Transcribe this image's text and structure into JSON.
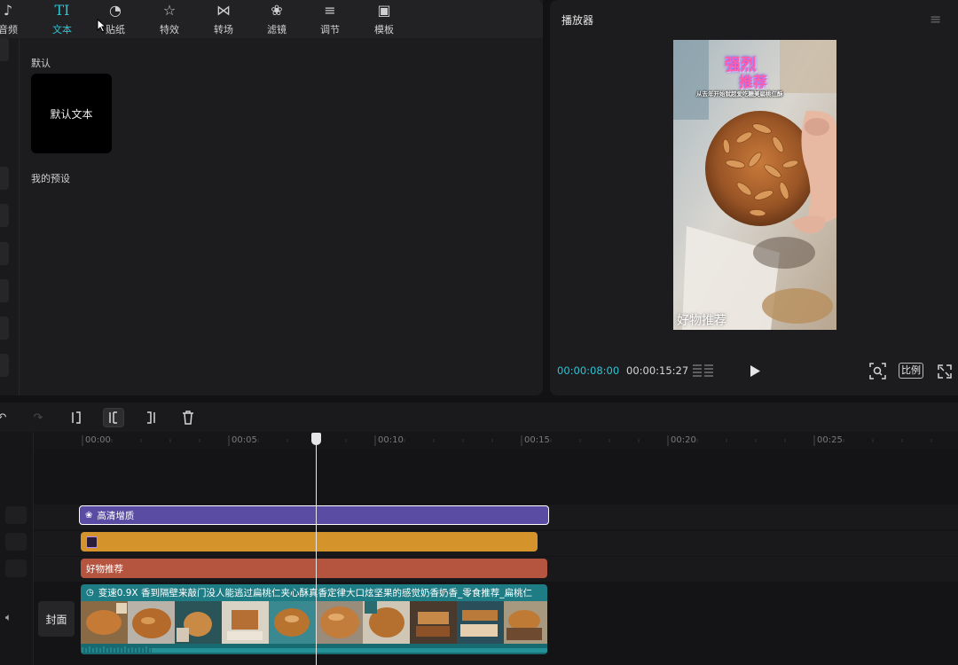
{
  "categories": [
    {
      "name": "audio",
      "label": "音频",
      "icon": "♪"
    },
    {
      "name": "text",
      "label": "文本",
      "icon": "TI"
    },
    {
      "name": "stickers",
      "label": "贴纸",
      "icon": "◔"
    },
    {
      "name": "effects",
      "label": "特效",
      "icon": "☆"
    },
    {
      "name": "transitions",
      "label": "转场",
      "icon": "⋈"
    },
    {
      "name": "filters",
      "label": "滤镜",
      "icon": "❀"
    },
    {
      "name": "adjust",
      "label": "调节",
      "icon": "≡"
    },
    {
      "name": "templates",
      "label": "模板",
      "icon": "▣"
    }
  ],
  "library": {
    "default_section": "默认",
    "default_text_card": "默认文本",
    "my_presets_section": "我的预设"
  },
  "player": {
    "title": "播放器",
    "current_time": "00:00:08:00",
    "total_time": "00:00:15:27",
    "ratio_label": "比例",
    "video_overlay_title_1": "强烈",
    "video_overlay_title_2": "推荐",
    "video_overlay_subtitle": "从去年开始就超爱吃糖美扁桃仁酥",
    "video_overlay_bottom": "好物推荐"
  },
  "timeline": {
    "ruler_labels": [
      "00:00",
      "00:05",
      "00:10",
      "00:15",
      "00:20",
      "00:25"
    ],
    "tracks": {
      "filter_clip": "高清增质",
      "text_clip": "好物推荐",
      "video_clip": "变速0.9X   香到隔壁来敲门没人能逃过扁桃仁夹心酥真香定律大口炫坚果的感觉奶香奶香_零食推荐_扁桃仁"
    },
    "cover_button": "封面"
  },
  "colors": {
    "accent": "#2dc5d6",
    "filter_track": "#5a4ba3",
    "sticker_track": "#d4932b",
    "text_track": "#b5543f",
    "video_track": "#1e7c84"
  }
}
